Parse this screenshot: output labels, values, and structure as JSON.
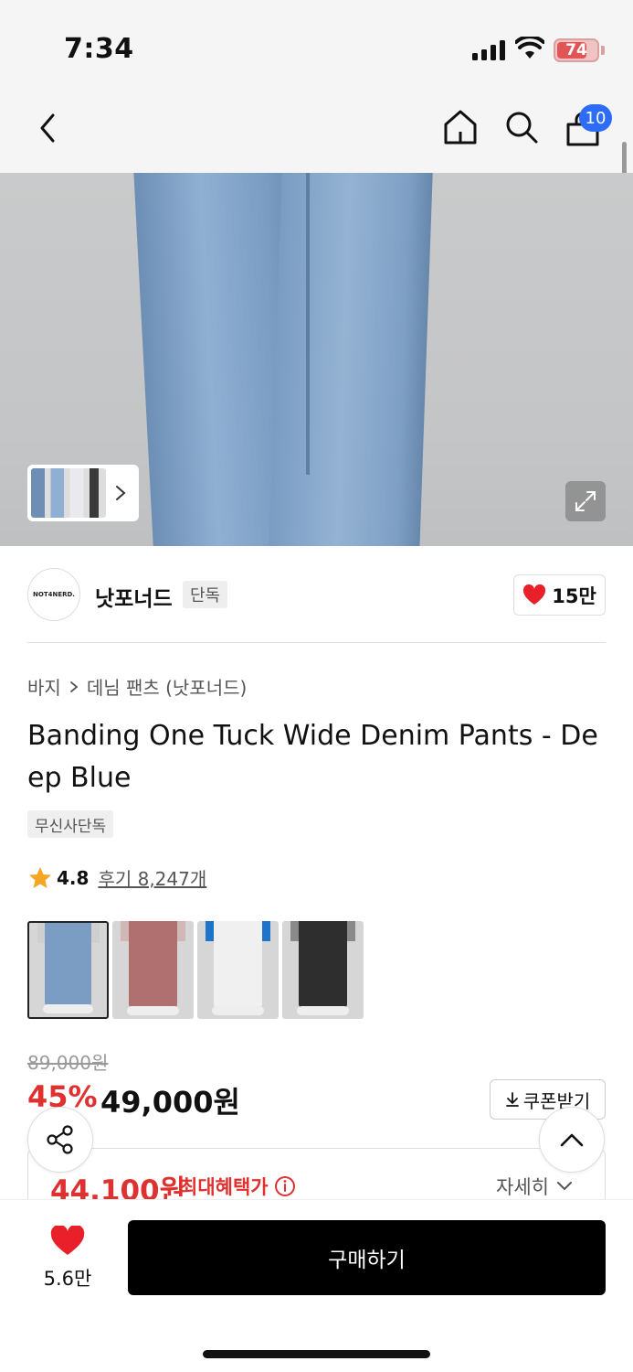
{
  "status_bar": {
    "time": "7:34",
    "battery": "74"
  },
  "nav": {
    "cart_count": "10"
  },
  "brand": {
    "logo_text": "NOT4NERD.",
    "name": "낫포너드",
    "exclusive_tag": "단독",
    "likes": "15만"
  },
  "product": {
    "breadcrumb": {
      "category": "바지",
      "subcategory": "데님 팬츠 (낫포너드)"
    },
    "title": "Banding One Tuck Wide Denim Pants - Deep Blue",
    "tag": "무신사단독",
    "rating": {
      "score": "4.8",
      "reviews": "후기 8,247개",
      "stars_value": 4.8
    },
    "variants": [
      {
        "name": "deep-blue",
        "pant_color": "#7b9dc4",
        "top_color": "#cfcfcf"
      },
      {
        "name": "pink",
        "pant_color": "#b07070",
        "top_color": "#d2b7b7"
      },
      {
        "name": "white",
        "pant_color": "#f0f0f0",
        "top_color": "#1f73c8"
      },
      {
        "name": "black",
        "pant_color": "#2e2e2e",
        "top_color": "#8a8a8a"
      }
    ]
  },
  "price": {
    "original": "89,000원",
    "discount": "45%",
    "sale": "49,000원",
    "coupon_label": "쿠폰받기",
    "max_benefit_price": "44,100원",
    "max_benefit_label": "최대혜택가",
    "detail_label": "자세히"
  },
  "bottom": {
    "wish_count": "5.6만",
    "buy_label": "구매하기"
  },
  "colors": {
    "accent_red": "#e03131",
    "badge_blue": "#2d6cf6",
    "buy_bg": "#000000"
  }
}
